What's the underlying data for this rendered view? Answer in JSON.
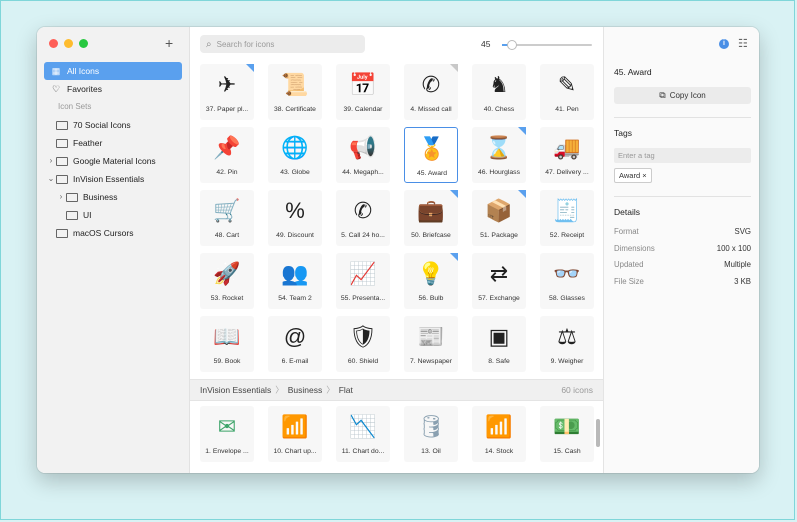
{
  "sidebar": {
    "items": [
      {
        "label": "All Icons",
        "icon": "grid-icon"
      },
      {
        "label": "Favorites",
        "icon": "heart-icon"
      }
    ],
    "section_label": "Icon Sets",
    "sets": [
      {
        "label": "70 Social Icons",
        "level": 0,
        "chevron": ""
      },
      {
        "label": "Feather",
        "level": 0,
        "chevron": ""
      },
      {
        "label": "Google Material Icons",
        "level": 0,
        "chevron": "›"
      },
      {
        "label": "InVision Essentials",
        "level": 0,
        "chevron": "⌄"
      },
      {
        "label": "Business",
        "level": 1,
        "chevron": "›"
      },
      {
        "label": "UI",
        "level": 1,
        "chevron": ""
      },
      {
        "label": "macOS Cursors",
        "level": 0,
        "chevron": ""
      }
    ]
  },
  "toolbar": {
    "search_placeholder": "Search for icons",
    "zoom_value": "45",
    "zoom_fraction": 0.05
  },
  "tiles": [
    {
      "label": "37. Paper pl...",
      "glyph": "✈",
      "corner": "blue"
    },
    {
      "label": "38. Certificate",
      "glyph": "📜",
      "corner": ""
    },
    {
      "label": "39. Calendar",
      "glyph": "📅",
      "corner": ""
    },
    {
      "label": "4. Missed call",
      "glyph": "✆",
      "corner": "gray"
    },
    {
      "label": "40. Chess",
      "glyph": "♞",
      "corner": ""
    },
    {
      "label": "41. Pen",
      "glyph": "✎",
      "corner": ""
    },
    {
      "label": "42. Pin",
      "glyph": "📌",
      "corner": ""
    },
    {
      "label": "43. Globe",
      "glyph": "🌐",
      "corner": ""
    },
    {
      "label": "44. Megaph...",
      "glyph": "📢",
      "corner": ""
    },
    {
      "label": "45. Award",
      "glyph": "🏅",
      "corner": "",
      "selected": true
    },
    {
      "label": "46. Hourglass",
      "glyph": "⌛",
      "corner": "blue"
    },
    {
      "label": "47. Delivery ...",
      "glyph": "🚚",
      "corner": ""
    },
    {
      "label": "48. Cart",
      "glyph": "🛒",
      "corner": ""
    },
    {
      "label": "49. Discount",
      "glyph": "%",
      "corner": ""
    },
    {
      "label": "5. Call 24 ho...",
      "glyph": "✆",
      "corner": ""
    },
    {
      "label": "50. Briefcase",
      "glyph": "💼",
      "corner": "blue"
    },
    {
      "label": "51. Package",
      "glyph": "📦",
      "corner": "blue"
    },
    {
      "label": "52. Receipt",
      "glyph": "🧾",
      "corner": ""
    },
    {
      "label": "53. Rocket",
      "glyph": "🚀",
      "corner": ""
    },
    {
      "label": "54. Team 2",
      "glyph": "👥",
      "corner": ""
    },
    {
      "label": "55. Presenta...",
      "glyph": "📈",
      "corner": ""
    },
    {
      "label": "56. Bulb",
      "glyph": "💡",
      "corner": "blue"
    },
    {
      "label": "57. Exchange",
      "glyph": "⇄",
      "corner": ""
    },
    {
      "label": "58. Glasses",
      "glyph": "👓",
      "corner": ""
    },
    {
      "label": "59. Book",
      "glyph": "📖",
      "corner": ""
    },
    {
      "label": "6. E-mail",
      "glyph": "@",
      "corner": ""
    },
    {
      "label": "60. Shield",
      "glyph": "🛡",
      "corner": ""
    },
    {
      "label": "7. Newspaper",
      "glyph": "📰",
      "corner": ""
    },
    {
      "label": "8. Safe",
      "glyph": "▣",
      "corner": ""
    },
    {
      "label": "9. Weigher",
      "glyph": "⚖",
      "corner": ""
    }
  ],
  "group": {
    "crumbs": [
      "InVision Essentials",
      "Business",
      "Flat"
    ],
    "count": "60 icons"
  },
  "flat_tiles": [
    {
      "label": "1. Envelope ...",
      "glyph": "✉",
      "color": "#3fa56b"
    },
    {
      "label": "10. Chart up...",
      "glyph": "📶",
      "color": "#3fa56b"
    },
    {
      "label": "11. Chart do...",
      "glyph": "📉",
      "color": "#e0605e"
    },
    {
      "label": "13. Oil",
      "glyph": "🛢",
      "color": "#8aa0b0"
    },
    {
      "label": "14. Stock",
      "glyph": "📶",
      "color": "#3d6fd6"
    },
    {
      "label": "15. Cash",
      "glyph": "💵",
      "color": "#3fa56b"
    }
  ],
  "panel": {
    "title": "45. Award",
    "copy_label": "Copy Icon",
    "tags_heading": "Tags",
    "tag_placeholder": "Enter a tag",
    "tags": [
      "Award ×"
    ],
    "details_heading": "Details",
    "details": [
      {
        "k": "Format",
        "v": "SVG"
      },
      {
        "k": "Dimensions",
        "v": "100 x 100"
      },
      {
        "k": "Updated",
        "v": "Multiple"
      },
      {
        "k": "File Size",
        "v": "3 KB"
      }
    ]
  },
  "colors": {
    "accent": "#5aa0ee",
    "selection": "#4a8fe6"
  }
}
